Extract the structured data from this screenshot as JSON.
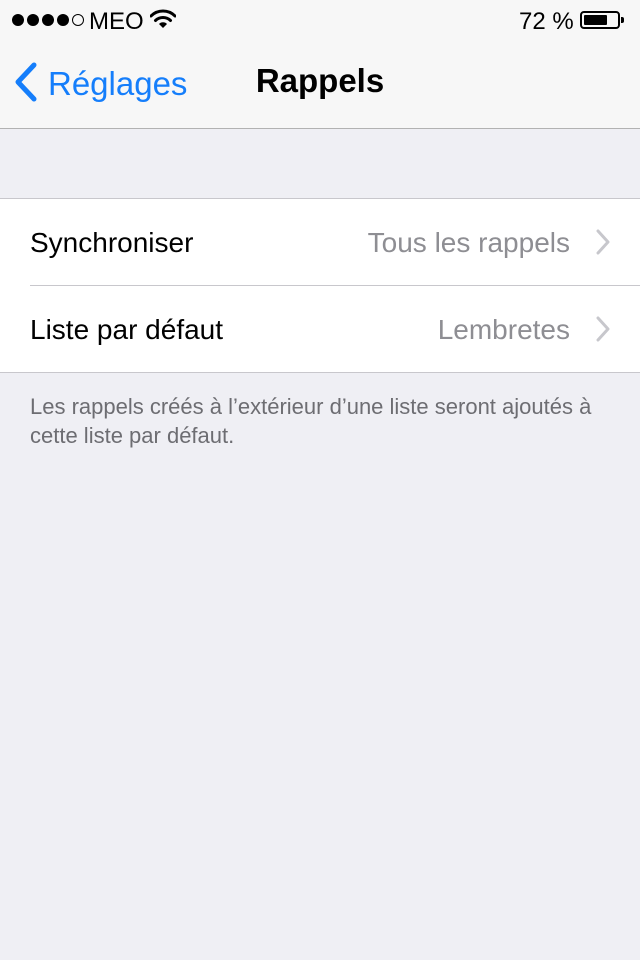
{
  "status_bar": {
    "carrier": "MEO",
    "battery_percent": "72 %",
    "battery_level": 0.72,
    "signal_bars_filled": 4,
    "signal_bars_total": 5
  },
  "nav": {
    "back_label": "Réglages",
    "title": "Rappels"
  },
  "settings": {
    "rows": [
      {
        "label": "Synchroniser",
        "value": "Tous les rappels"
      },
      {
        "label": "Liste par défaut",
        "value": "Lembretes"
      }
    ],
    "footer": "Les rappels créés à l’extérieur d’une liste seront ajoutés à cette liste par défaut."
  },
  "colors": {
    "accent": "#157efb",
    "background": "#efeff4",
    "secondary_text": "#8e8e93"
  }
}
